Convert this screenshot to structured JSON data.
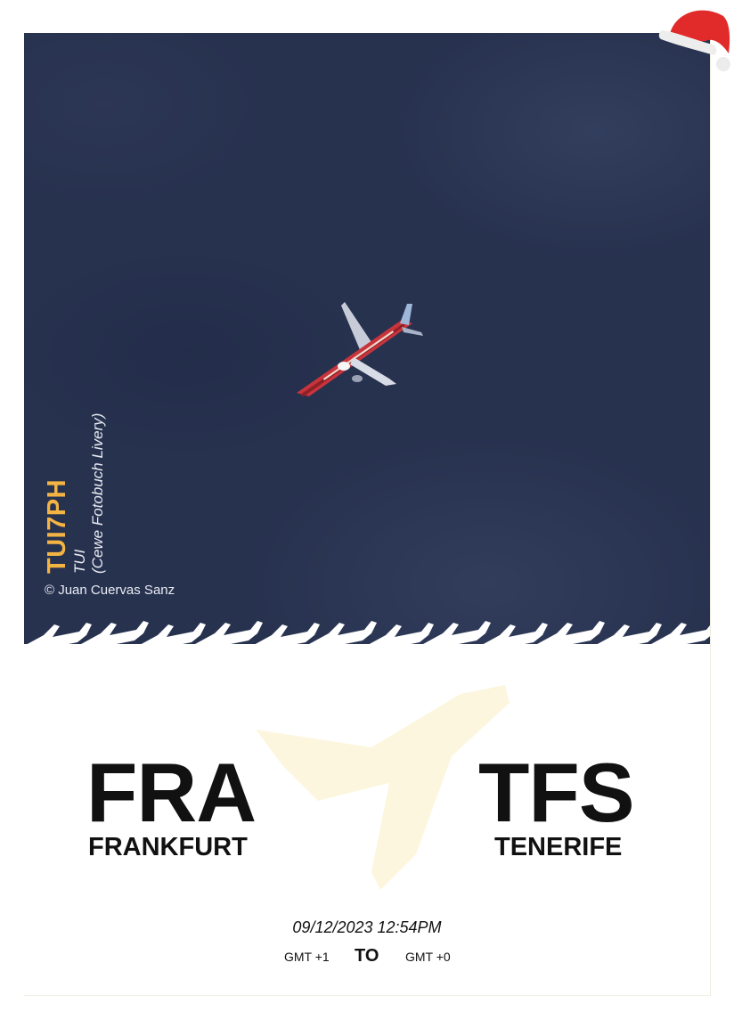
{
  "photo": {
    "registration": "TUI7PH",
    "airline": "TUI",
    "livery": "(Cewe Fotobuch Livery)",
    "copyright": "© Juan Cuervas Sanz"
  },
  "route": {
    "origin_code": "FRA",
    "origin_city": "FRANKFURT",
    "destination_code": "TFS",
    "destination_city": "TENERIFE"
  },
  "flight": {
    "datetime": "09/12/2023 12:54PM",
    "origin_tz": "GMT +1",
    "separator": "TO",
    "destination_tz": "GMT +0"
  },
  "colors": {
    "sky": "#27324f",
    "registration": "#f3b443",
    "text": "#111111",
    "watermark": "#fdf6df",
    "aircraft_livery": "#c9343c"
  },
  "icons": {
    "watermark": "airplane-watermark-icon",
    "border": "airplane-pattern-border",
    "decoration": "santa-hat-icon"
  }
}
